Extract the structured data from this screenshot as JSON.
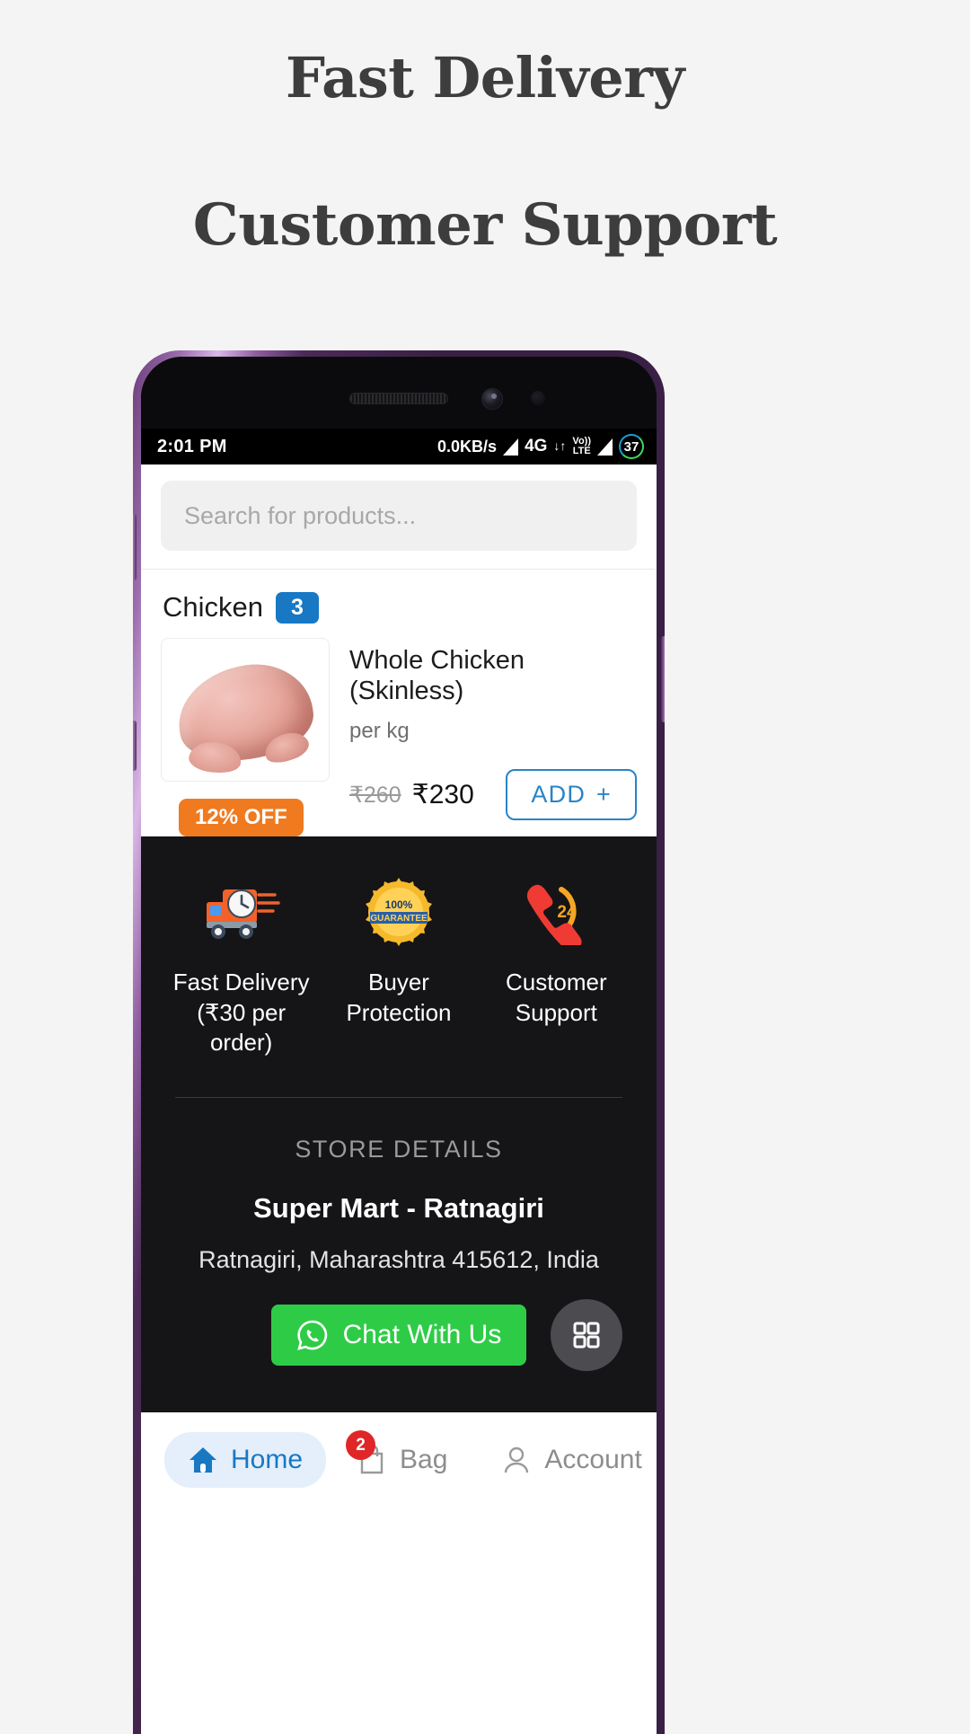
{
  "promo": {
    "line1": "Fast Delivery",
    "line2": "Customer Support"
  },
  "statusbar": {
    "time": "2:01 PM",
    "network_speed": "0.0KB/s",
    "network_type": "4G",
    "volte_top": "Vo))",
    "volte_bottom": "LTE",
    "battery_percent": "37"
  },
  "search": {
    "placeholder": "Search for products..."
  },
  "category": {
    "name": "Chicken",
    "count": "3"
  },
  "product": {
    "title": "Whole Chicken (Skinless)",
    "unit": "per kg",
    "price_old": "₹260",
    "price_new": "₹230",
    "discount_badge": "12% OFF",
    "add_label": "ADD",
    "add_plus": "+"
  },
  "features": [
    {
      "label": "Fast Delivery (₹30 per order)",
      "icon": "delivery-truck-icon"
    },
    {
      "label": "Buyer Protection",
      "icon": "guarantee-badge-icon"
    },
    {
      "label": "Customer Support",
      "icon": "support-phone-24-icon"
    }
  ],
  "guarantee_icon_text": {
    "top": "100%",
    "bottom": "GUARANTEE"
  },
  "support_icon_text": "24",
  "store": {
    "heading": "STORE DETAILS",
    "name": "Super Mart - Ratnagiri",
    "address": "Ratnagiri, Maharashtra 415612, India",
    "chat_label": "Chat With Us"
  },
  "bottom_nav": [
    {
      "label": "Home",
      "icon": "home-icon",
      "active": true,
      "badge": ""
    },
    {
      "label": "Bag",
      "icon": "bag-icon",
      "active": false,
      "badge": "2"
    },
    {
      "label": "Account",
      "icon": "person-icon",
      "active": false,
      "badge": ""
    }
  ],
  "colors": {
    "accent_blue": "#1878c4",
    "badge_orange": "#ef7a20",
    "whatsapp_green": "#2ecc46",
    "dark_bg": "#151517",
    "page_bg": "#f4f4f4"
  }
}
